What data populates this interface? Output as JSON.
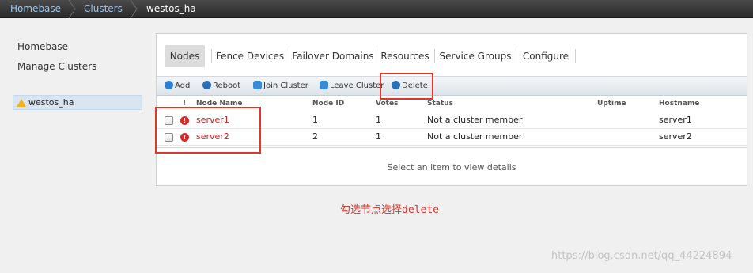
{
  "breadcrumb": {
    "items": [
      "Homebase",
      "Clusters",
      "westos_ha"
    ]
  },
  "leftnav": {
    "links": [
      "Homebase",
      "Manage Clusters"
    ],
    "cluster": "westos_ha"
  },
  "tabs": [
    "Nodes",
    "Fence Devices",
    "Failover Domains",
    "Resources",
    "Service Groups",
    "Configure"
  ],
  "active_tab": "Nodes",
  "toolbar": {
    "add": "Add",
    "reboot": "Reboot",
    "join": "Join Cluster",
    "leave": "Leave Cluster",
    "delete": "Delete"
  },
  "table": {
    "headers": {
      "bang": "!",
      "node_name": "Node Name",
      "node_id": "Node ID",
      "votes": "Votes",
      "status": "Status",
      "uptime": "Uptime",
      "hostname": "Hostname"
    },
    "rows": [
      {
        "node_name": "server1",
        "node_id": "1",
        "votes": "1",
        "status": "Not a cluster member",
        "uptime": "",
        "hostname": "server1",
        "status_icon": "error-icon"
      },
      {
        "node_name": "server2",
        "node_id": "2",
        "votes": "1",
        "status": "Not a cluster member",
        "uptime": "",
        "hostname": "server2",
        "status_icon": "error-icon"
      }
    ]
  },
  "details": "Select an item to view details",
  "annotation": "勾选节点选择delete",
  "watermark": "https://blog.csdn.net/qq_44224894",
  "colors": {
    "link_blue": "#9ec6ea",
    "error_red": "#d42a2a",
    "annotation_red": "#e0352b",
    "selected_bg": "#d9e6f2"
  }
}
